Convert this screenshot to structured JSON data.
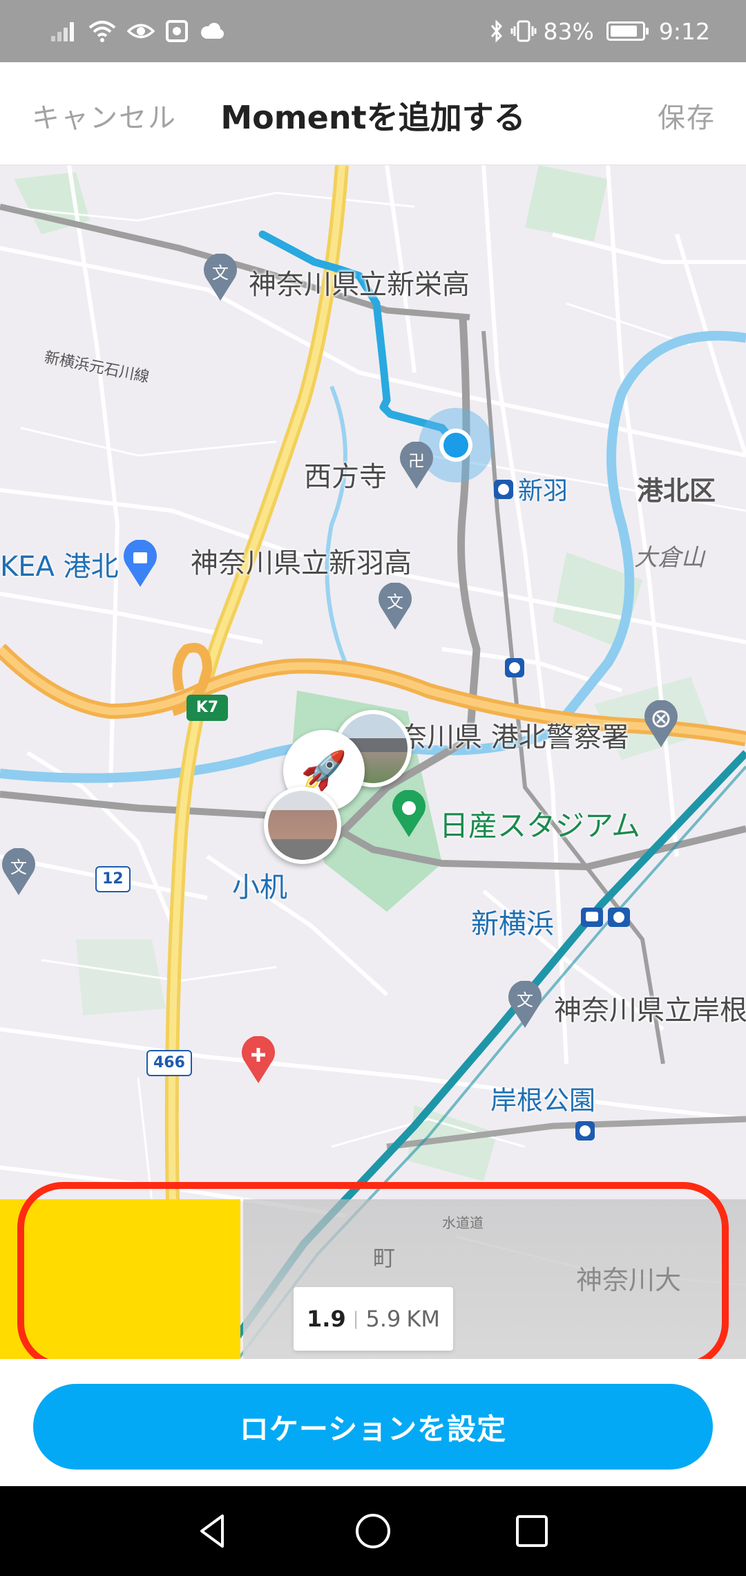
{
  "status_bar": {
    "battery_percent": "83%",
    "time": "9:12",
    "left_icons": [
      "signal-icon",
      "wifi-icon",
      "eye-icon",
      "camera-square-icon",
      "weather-icon"
    ],
    "right_icons": [
      "bluetooth-icon",
      "vibrate-icon",
      "battery-icon"
    ]
  },
  "header": {
    "cancel_label": "キャンセル",
    "title": "Momentを追加する",
    "save_label": "保存"
  },
  "map": {
    "labels": {
      "school_shinei": "神奈川県立新栄高",
      "road_name": "新横浜元石川線",
      "temple": "西方寺",
      "station_nippa": "新羽",
      "district": "港北区",
      "okurayama": "大倉山",
      "ikea": "KEA 港北",
      "school_nippa": "神奈川県立新羽高",
      "police": "奈川県 港北警察署",
      "stadium": "日産スタジアム",
      "kozukue": "小机",
      "shin_yokohama": "新横浜",
      "school_kishine": "神奈川県立岸根",
      "kishine_park": "岸根公園",
      "suidomichi": "水道道",
      "machi": "町",
      "kanagawa_univ": "神奈川大"
    },
    "route_badges": {
      "k7": "K7",
      "r12": "12",
      "r466": "466"
    },
    "markers": [
      "current-location",
      "rocket-moment",
      "stadium-photo",
      "station-photo"
    ]
  },
  "distance": {
    "current": "1.9",
    "total": "5.9",
    "unit": "KM",
    "progress_fraction": 0.322
  },
  "actions": {
    "set_location_label": "ロケーションを設定"
  },
  "colors": {
    "accent_blue": "#03a9f4",
    "progress_yellow": "#ffdb00",
    "highlight_red": "#ff2a12"
  }
}
